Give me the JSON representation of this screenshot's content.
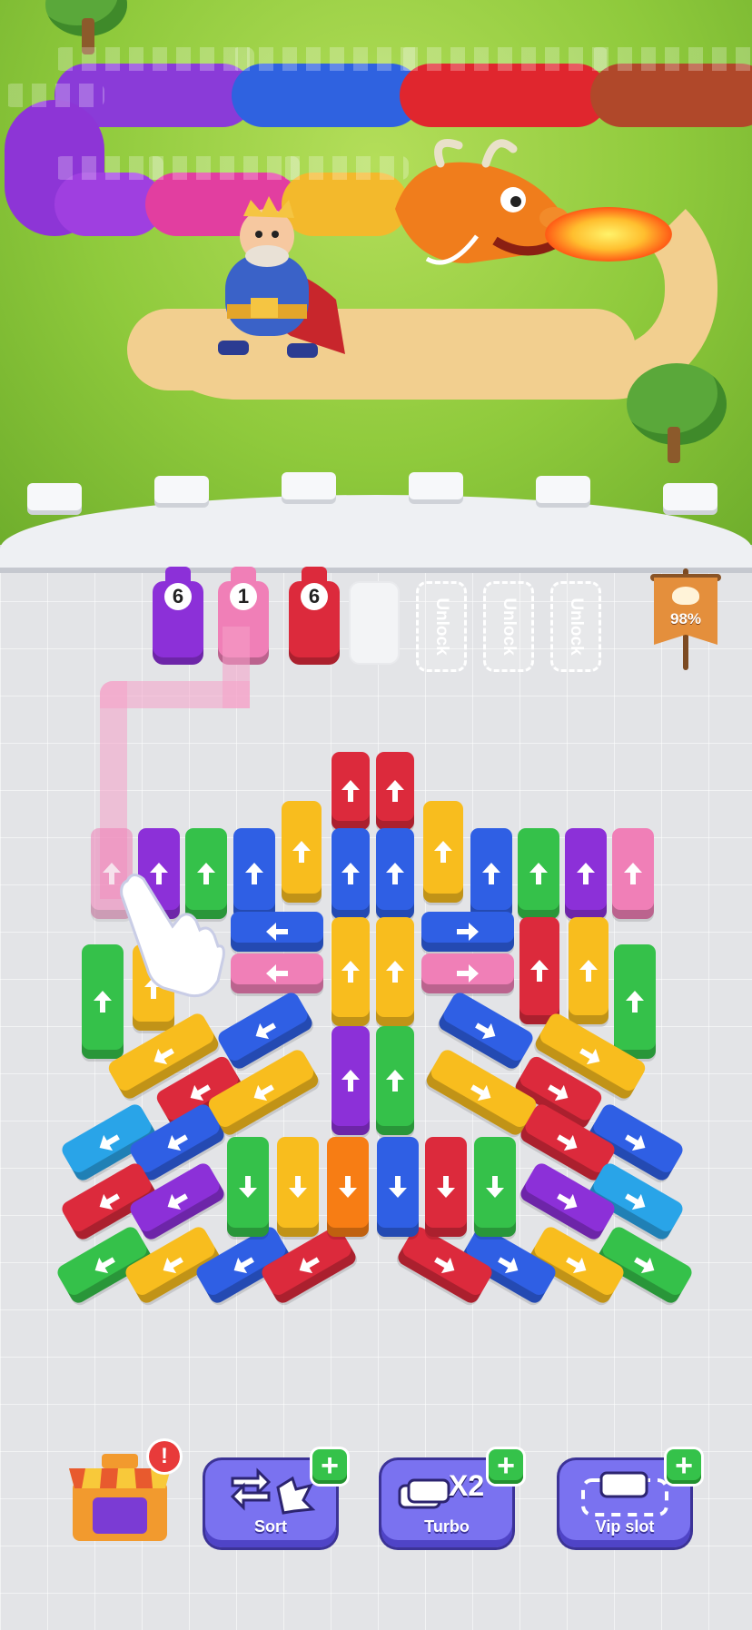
{
  "colors": {
    "red": "#dc2a3c",
    "blue": "#2f5fe4",
    "yellow": "#f8bd1e",
    "green": "#35c14a",
    "purple": "#8c30d8",
    "pink": "#f07fb7",
    "orange": "#f77d14",
    "sky": "#29a4e8"
  },
  "slots": [
    {
      "state": "filled",
      "color": "purple",
      "count": "6"
    },
    {
      "state": "filled",
      "color": "pink",
      "count": "1"
    },
    {
      "state": "filled",
      "color": "red",
      "count": "6"
    },
    {
      "state": "empty"
    },
    {
      "state": "locked",
      "label": "Unlock"
    },
    {
      "state": "locked",
      "label": "Unlock"
    },
    {
      "state": "locked",
      "label": "Unlock"
    }
  ],
  "progress": {
    "label": "98%",
    "value": 0.98
  },
  "tools": [
    {
      "label": "Sort",
      "icon": "sort-icon"
    },
    {
      "label": "Turbo",
      "icon": "turbo-icon",
      "multiplier": "X2"
    },
    {
      "label": "Vip slot",
      "icon": "vip-slot-icon"
    }
  ],
  "shop": {
    "icon": "shop-icon",
    "alert": "!"
  },
  "plus_label": "+"
}
